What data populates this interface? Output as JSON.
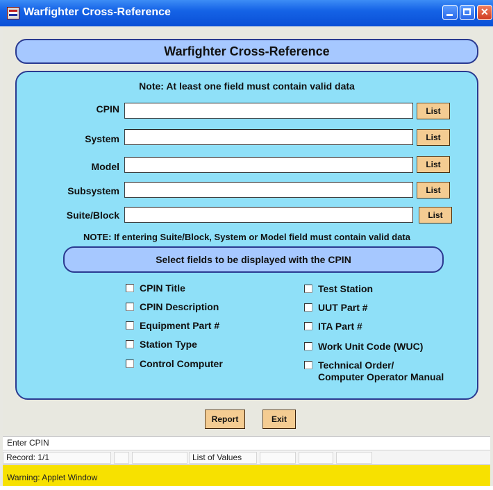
{
  "window": {
    "title": "Warfighter Cross-Reference"
  },
  "header": {
    "title": "Warfighter Cross-Reference"
  },
  "form": {
    "note_top": "Note: At least one field must contain valid data",
    "fields": [
      {
        "label": "CPIN",
        "value": "",
        "button": "List"
      },
      {
        "label": "System",
        "value": "",
        "button": "List"
      },
      {
        "label": "Model",
        "value": "",
        "button": "List"
      },
      {
        "label": "Subsystem",
        "value": "",
        "button": "List"
      },
      {
        "label": "Suite/Block",
        "value": "",
        "button": "List"
      }
    ],
    "note_mid": "NOTE: If entering Suite/Block, System or Model field must contain valid data"
  },
  "select_fields": {
    "title": "Select fields to be displayed with the CPIN",
    "left": [
      {
        "label": "CPIN Title",
        "checked": false
      },
      {
        "label": "CPIN Description",
        "checked": false
      },
      {
        "label": "Equipment Part #",
        "checked": false
      },
      {
        "label": "Station Type",
        "checked": false
      },
      {
        "label": "Control Computer",
        "checked": false
      }
    ],
    "right": [
      {
        "label": "Test Station",
        "checked": false
      },
      {
        "label": "UUT Part #",
        "checked": false
      },
      {
        "label": "ITA Part #",
        "checked": false
      },
      {
        "label": "Work Unit Code (WUC)",
        "checked": false
      },
      {
        "label": "Technical Order/",
        "label2": "Computer Operator Manual",
        "checked": false
      }
    ]
  },
  "actions": {
    "report": "Report",
    "exit": "Exit"
  },
  "status": {
    "message": "Enter CPIN",
    "record": "Record: 1/1",
    "list_of_values": "List of Values",
    "warning": "Warning: Applet Window"
  }
}
